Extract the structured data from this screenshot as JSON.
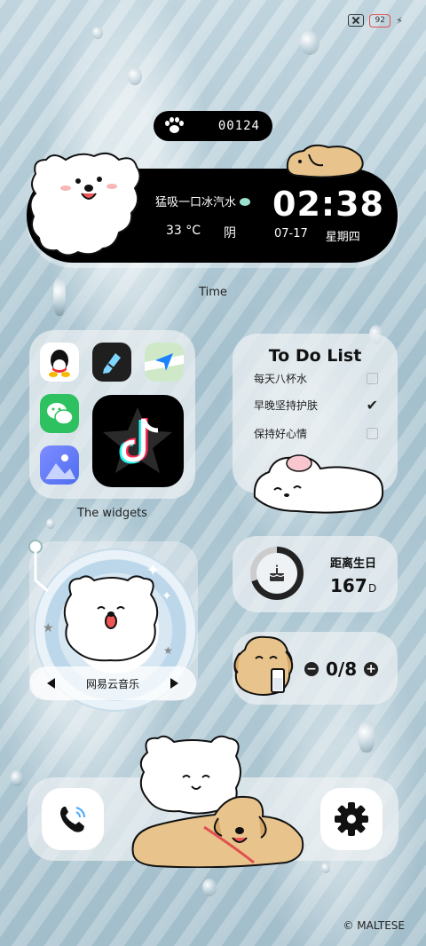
{
  "status": {
    "battery": "92",
    "charging_icon": "bolt-icon",
    "sim_icon": "no-sim-icon"
  },
  "counter": {
    "icon": "paw-icon",
    "value": "00124"
  },
  "time_widget": {
    "activity": "猛吸一口冰汽水",
    "temperature": "33 °C",
    "condition": "阴",
    "clock": "02:38",
    "date": "07-17",
    "weekday": "星期四",
    "label": "Time"
  },
  "apps": {
    "label": "The widgets",
    "items": [
      {
        "name": "qq-app",
        "color": "#ffffff"
      },
      {
        "name": "pen-app",
        "color": "#1f1f1f"
      },
      {
        "name": "maps-app",
        "color": "#d9f0ff"
      },
      {
        "name": "wechat-app",
        "color": "#2dc160"
      },
      {
        "name": "tiktok-app",
        "color": "#000000"
      },
      {
        "name": "gallery-app",
        "color": "#6f7df0"
      }
    ]
  },
  "todo": {
    "title": "To Do List",
    "items": [
      {
        "label": "每天八杯水",
        "checked": false
      },
      {
        "label": "早晚坚持护肤",
        "checked": true
      },
      {
        "label": "保持好心情",
        "checked": false
      }
    ]
  },
  "music": {
    "label": "网易云音乐"
  },
  "birthday": {
    "title": "距离生日",
    "days": "167",
    "unit": "D",
    "progress": 0.7
  },
  "water": {
    "value": "0/8"
  },
  "dock": {
    "left_icon": "phone-icon",
    "right_icon": "settings-gear-icon"
  },
  "credit": "© MALTESE"
}
